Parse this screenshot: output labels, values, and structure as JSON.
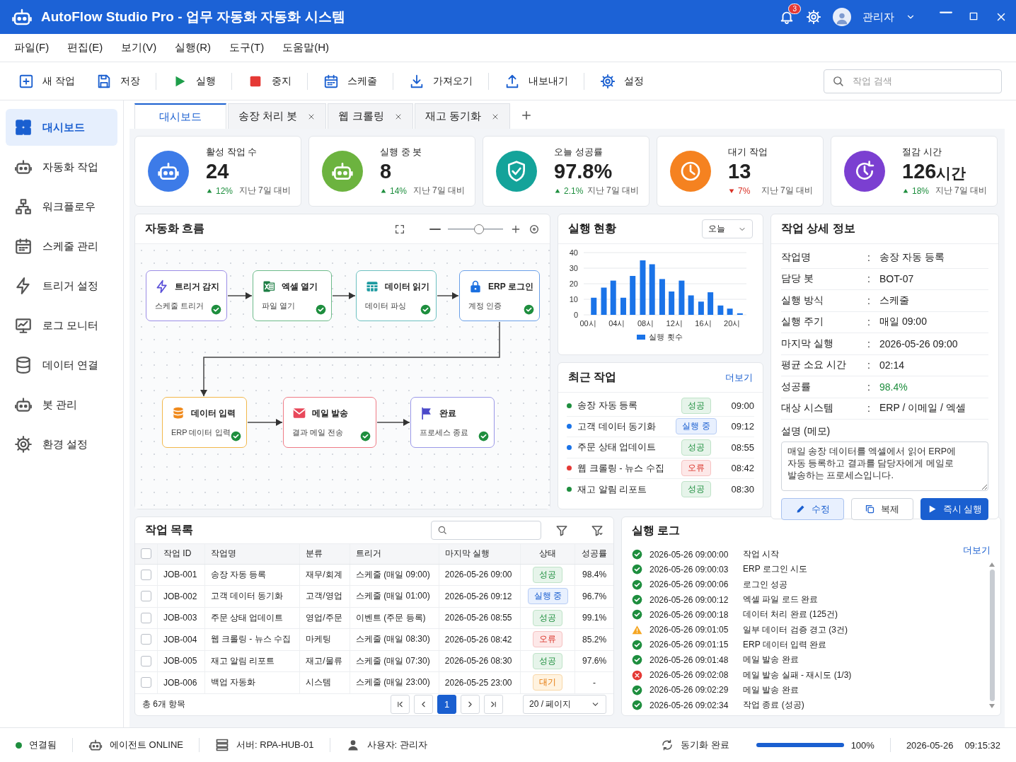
{
  "window": {
    "title": "AutoFlow Studio Pro - 업무 자동화 자동화 시스템",
    "notifications": "3",
    "user": "관리자"
  },
  "menu": [
    "파일(F)",
    "편집(E)",
    "보기(V)",
    "실행(R)",
    "도구(T)",
    "도움말(H)"
  ],
  "toolbar": {
    "buttons": [
      "새 작업",
      "저장",
      "실행",
      "중지",
      "스케줄",
      "가져오기",
      "내보내기",
      "설정"
    ],
    "search": {
      "placeholder": "작업 검색"
    }
  },
  "sidebar": {
    "items": [
      {
        "label": "대시보드",
        "selected": true
      },
      {
        "label": "자동화 작업",
        "selected": false
      },
      {
        "label": "워크플로우",
        "selected": false
      },
      {
        "label": "스케줄 관리",
        "selected": false
      },
      {
        "label": "트리거 설정",
        "selected": false
      },
      {
        "label": "로그 모니터",
        "selected": false
      },
      {
        "label": "데이터 연결",
        "selected": false
      },
      {
        "label": "봇 관리",
        "selected": false
      },
      {
        "label": "환경 설정",
        "selected": false
      }
    ]
  },
  "tabs": [
    {
      "label": "대시보드",
      "selected": true,
      "closable": false
    },
    {
      "label": "송장 처리 봇",
      "selected": false,
      "closable": true
    },
    {
      "label": "웹 크롤링",
      "selected": false,
      "closable": true
    },
    {
      "label": "재고 동기화",
      "selected": false,
      "closable": true
    }
  ],
  "kpis": [
    {
      "label": "활성 작업 수",
      "value": "24",
      "rising": true,
      "delta": "12%",
      "note": "지난 7일 대비",
      "color": "#3d7be8"
    },
    {
      "label": "실행 중 봇",
      "value": "8",
      "rising": true,
      "delta": "14%",
      "note": "지난 7일 대비",
      "color": "#6cb33f"
    },
    {
      "label": "오늘 성공률",
      "value": "97.8%",
      "rising": true,
      "delta": "2.1%",
      "note": "지난 7일 대비",
      "color": "#14a39a"
    },
    {
      "label": "대기 작업",
      "value": "13",
      "rising": false,
      "delta": "7%",
      "note": "지난 7일 대비",
      "color": "#f58220"
    },
    {
      "label": "절감 시간",
      "value": "126",
      "unit": "시간",
      "rising": true,
      "delta": "18%",
      "note": "지난 7일 대비",
      "color": "#7b3fd1"
    }
  ],
  "flow": {
    "title": "자동화 흐름",
    "zoom": {
      "level": 0.56
    },
    "nodes": [
      {
        "title": "트리거 감지",
        "subtitle": "스케줄 트리거",
        "color": "#9b8de6",
        "done": true
      },
      {
        "title": "엑셀 열기",
        "subtitle": "파일 열기",
        "color": "#6dbb8a",
        "done": true
      },
      {
        "title": "데이터 읽기",
        "subtitle": "데이터 파싱",
        "color": "#6cc0c0",
        "done": true
      },
      {
        "title": "ERP 로그인",
        "subtitle": "계정 인증",
        "color": "#6aa0e8",
        "done": true
      },
      {
        "title": "데이터 입력",
        "subtitle": "ERP 데이터 입력",
        "color": "#f2b84b",
        "done": true
      },
      {
        "title": "메일 발송",
        "subtitle": "결과 메일 전송",
        "color": "#ef7b86",
        "done": true
      },
      {
        "title": "완료",
        "subtitle": "프로세스 종료",
        "color": "#9a98e8",
        "done": true
      }
    ]
  },
  "execution": {
    "title": "실행 현황",
    "period": "오늘",
    "chart_data": {
      "type": "bar",
      "x": [
        0.8,
        2.2,
        3.5,
        4.9,
        6.2,
        7.6,
        8.9,
        10.3,
        11.6,
        13.0,
        14.3,
        15.7,
        17.0,
        18.4,
        19.7,
        21.1
      ],
      "series": [
        {
          "name": "실행 횟수",
          "color": "#1a73e8",
          "values": [
            11,
            17.5,
            22,
            11,
            25,
            35,
            32.5,
            23,
            15,
            22,
            12.5,
            8.5,
            14.5,
            6,
            4,
            1
          ]
        }
      ],
      "grid": true,
      "xlim": [
        -0.6,
        22
      ],
      "ylim": [
        0,
        40
      ],
      "yticks": [
        0,
        10,
        20,
        30,
        40
      ],
      "xticks": [
        {
          "value": 0,
          "label": "00시"
        },
        {
          "value": 4,
          "label": "04시"
        },
        {
          "value": 8,
          "label": "08시"
        },
        {
          "value": 12,
          "label": "12시"
        },
        {
          "value": 16,
          "label": "16시"
        },
        {
          "value": 20,
          "label": "20시"
        }
      ]
    }
  },
  "recent": {
    "title": "최근 작업",
    "more": "더보기",
    "items": [
      {
        "name": "송장 자동 등록",
        "status": "성공",
        "kind": "success",
        "time": "09:00",
        "color": "#1e8e3e"
      },
      {
        "name": "고객 데이터 동기화",
        "status": "실행 중",
        "kind": "running",
        "time": "09:12",
        "color": "#1a73e8"
      },
      {
        "name": "주문 상태 업데이트",
        "status": "성공",
        "kind": "success",
        "time": "08:55",
        "color": "#1a73e8"
      },
      {
        "name": "웹 크롤링 - 뉴스 수집",
        "status": "오류",
        "kind": "error",
        "time": "08:42",
        "color": "#e53935"
      },
      {
        "name": "재고 알림 리포트",
        "status": "성공",
        "kind": "success",
        "time": "08:30",
        "color": "#1e8e3e"
      }
    ]
  },
  "detail": {
    "title": "작업 상세 정보",
    "fields": [
      {
        "label": "작업명",
        "sep": ":",
        "value": "송장 자동 등록",
        "emphasis": false
      },
      {
        "label": "담당 봇",
        "sep": ":",
        "value": "BOT-07",
        "emphasis": false
      },
      {
        "label": "실행 방식",
        "sep": ":",
        "value": "스케줄",
        "emphasis": false
      },
      {
        "label": "실행 주기",
        "sep": ":",
        "value": "매일 09:00",
        "emphasis": false
      },
      {
        "label": "마지막 실행",
        "sep": ":",
        "value": "2026-05-26 09:00",
        "emphasis": false
      },
      {
        "label": "평균 소요 시간",
        "sep": ":",
        "value": "02:14",
        "emphasis": false
      },
      {
        "label": "성공률",
        "sep": ":",
        "value": "98.4%",
        "emphasis": true
      },
      {
        "label": "대상 시스템",
        "sep": ":",
        "value": "ERP / 이메일 / 엑셀",
        "emphasis": false
      }
    ],
    "memo_label": "설명 (메모)",
    "memo": "매일 송장 데이터를 엑셀에서 읽어 ERP에\n자동 등록하고 결과를 담당자에게 메일로\n발송하는 프로세스입니다.",
    "buttons": [
      {
        "label": "수정",
        "kind": "edit"
      },
      {
        "label": "복제",
        "kind": "copy"
      },
      {
        "label": "즉시 실행",
        "kind": "run"
      }
    ]
  },
  "jobs": {
    "title": "작업 목록",
    "header_checked": false,
    "columns": [
      "작업 ID",
      "작업명",
      "분류",
      "트리거",
      "마지막 실행",
      "상태",
      "성공률"
    ],
    "rows": [
      {
        "checked": false,
        "id": "JOB-001",
        "name": "송장 자동 등록",
        "category": "재무/회계",
        "trigger": "스케줄 (매일 09:00)",
        "last_run": "2026-05-26 09:00",
        "status": "성공",
        "kind": "success",
        "rate": "98.4%"
      },
      {
        "checked": false,
        "id": "JOB-002",
        "name": "고객 데이터 동기화",
        "category": "고객/영업",
        "trigger": "스케줄 (매일 01:00)",
        "last_run": "2026-05-26 09:12",
        "status": "실행 중",
        "kind": "running",
        "rate": "96.7%"
      },
      {
        "checked": false,
        "id": "JOB-003",
        "name": "주문 상태 업데이트",
        "category": "영업/주문",
        "trigger": "이벤트 (주문 등록)",
        "last_run": "2026-05-26 08:55",
        "status": "성공",
        "kind": "success",
        "rate": "99.1%"
      },
      {
        "checked": false,
        "id": "JOB-004",
        "name": "웹 크롤링 - 뉴스 수집",
        "category": "마케팅",
        "trigger": "스케줄 (매일 08:30)",
        "last_run": "2026-05-26 08:42",
        "status": "오류",
        "kind": "error",
        "rate": "85.2%"
      },
      {
        "checked": false,
        "id": "JOB-005",
        "name": "재고 알림 리포트",
        "category": "재고/물류",
        "trigger": "스케줄 (매일 07:30)",
        "last_run": "2026-05-26 08:30",
        "status": "성공",
        "kind": "success",
        "rate": "97.6%"
      },
      {
        "checked": false,
        "id": "JOB-006",
        "name": "백업 자동화",
        "category": "시스템",
        "trigger": "스케줄 (매일 23:00)",
        "last_run": "2026-05-25 23:00",
        "status": "대기",
        "kind": "pending",
        "rate": "-"
      }
    ],
    "total": "총 6개 항목",
    "pages": [
      {
        "label": "1",
        "selected": true
      }
    ],
    "page_size": "20 / 페이지"
  },
  "log": {
    "title": "실행 로그",
    "more": "더보기",
    "entries": [
      {
        "kind": "ok",
        "time": "2026-05-26 09:00:00",
        "message": "작업 시작"
      },
      {
        "kind": "ok",
        "time": "2026-05-26 09:00:03",
        "message": "ERP 로그인 시도"
      },
      {
        "kind": "ok",
        "time": "2026-05-26 09:00:06",
        "message": "로그인 성공"
      },
      {
        "kind": "ok",
        "time": "2026-05-26 09:00:12",
        "message": "엑셀 파일 로드 완료"
      },
      {
        "kind": "ok",
        "time": "2026-05-26 09:00:18",
        "message": "데이터 처리 완료 (125건)"
      },
      {
        "kind": "warn",
        "time": "2026-05-26 09:01:05",
        "message": "일부 데이터 검증 경고 (3건)"
      },
      {
        "kind": "ok",
        "time": "2026-05-26 09:01:15",
        "message": "ERP 데이터 입력 완료"
      },
      {
        "kind": "ok",
        "time": "2026-05-26 09:01:48",
        "message": "메일 발송 완료"
      },
      {
        "kind": "error",
        "time": "2026-05-26 09:02:08",
        "message": "메일 발송 실패 - 재시도 (1/3)"
      },
      {
        "kind": "ok",
        "time": "2026-05-26 09:02:29",
        "message": "메일 발송 완료"
      },
      {
        "kind": "ok",
        "time": "2026-05-26 09:02:34",
        "message": "작업 종료 (성공)"
      }
    ]
  },
  "status_bar": {
    "connection": {
      "label": "연결됨",
      "connected": true
    },
    "agent": "에이전트 ONLINE",
    "server": "서버: RPA-HUB-01",
    "user": "사용자: 관리자",
    "sync": "동기화 완료",
    "sync_progress": {
      "level": 1,
      "reading": "100%"
    },
    "date": "2026-05-26",
    "time": "09:15:32"
  }
}
